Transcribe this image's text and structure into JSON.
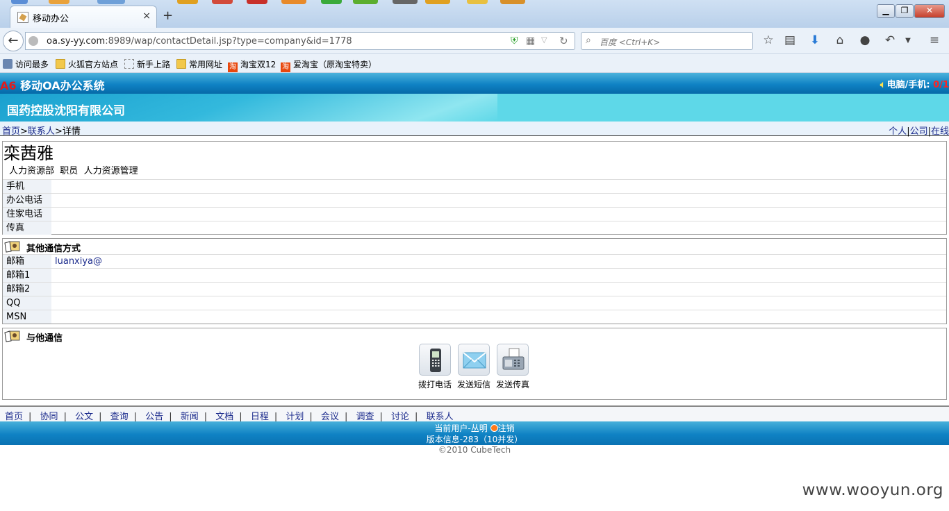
{
  "browser": {
    "tab_title": "移动办公",
    "tab_close": "×",
    "new_tab": "+",
    "url_host": "oa.sy-yy.com",
    "url_rest": ":8989/wap/contactDetail.jsp?type=company&id=1778",
    "search_placeholder": "百度 <Ctrl+K>",
    "window_buttons": {
      "minimize": "▁",
      "maximize": "❐",
      "close": "✕"
    },
    "bookmarks": [
      {
        "label": "访问最多",
        "icon": "most-visited-icon"
      },
      {
        "label": "火狐官方站点",
        "icon": "folder-icon"
      },
      {
        "label": "新手上路",
        "icon": "dotted-page-icon"
      },
      {
        "label": "常用网址",
        "icon": "folder-icon"
      },
      {
        "label": "淘宝双12",
        "icon": "taobao-icon"
      },
      {
        "label": "爱淘宝（原淘宝特卖）",
        "icon": "taobao-icon"
      }
    ]
  },
  "app": {
    "brand_prefix": "A6",
    "brand_name": "移动OA办公系统",
    "status_label": "电脑/手机:",
    "status_value": "0/1",
    "company": "国药控股沈阳有限公司"
  },
  "breadcrumb": {
    "home": "首页",
    "sep1": ">",
    "contacts": "联系人",
    "sep2": ">",
    "current": "详情",
    "right_personal": "个人",
    "right_sep1": "|",
    "right_company": "公司",
    "right_sep2": "|",
    "right_online": "在线"
  },
  "contact": {
    "name": "栾茜雅",
    "department": "人力资源部",
    "position": "职员",
    "duty": "人力资源管理",
    "fields": [
      {
        "label": "手机",
        "value": ""
      },
      {
        "label": "办公电话",
        "value": ""
      },
      {
        "label": "住家电话",
        "value": ""
      },
      {
        "label": "传真",
        "value": ""
      }
    ]
  },
  "other_comm": {
    "title": "其他通信方式",
    "fields": [
      {
        "label": "邮箱",
        "value": "luanxiya@"
      },
      {
        "label": "邮箱1",
        "value": ""
      },
      {
        "label": "邮箱2",
        "value": ""
      },
      {
        "label": "QQ",
        "value": ""
      },
      {
        "label": "MSN",
        "value": ""
      }
    ]
  },
  "communicate": {
    "title": "与他通信",
    "actions": [
      {
        "label": "拨打电话",
        "icon": "mobile-phone-icon"
      },
      {
        "label": "发送短信",
        "icon": "envelope-icon"
      },
      {
        "label": "发送传真",
        "icon": "fax-icon"
      }
    ]
  },
  "footer": {
    "links": [
      "首页",
      "协同",
      "公文",
      "查询",
      "公告",
      "新闻",
      "文档",
      "日程",
      "计划",
      "会议",
      "调查",
      "讨论",
      "联系人"
    ],
    "separator": "|",
    "current_user": "当前用户-丛明",
    "logout": "注销",
    "version": "版本信息-283（10并发）",
    "copyright": "©2010 CubeTech"
  },
  "watermark": "www.wooyun.org"
}
